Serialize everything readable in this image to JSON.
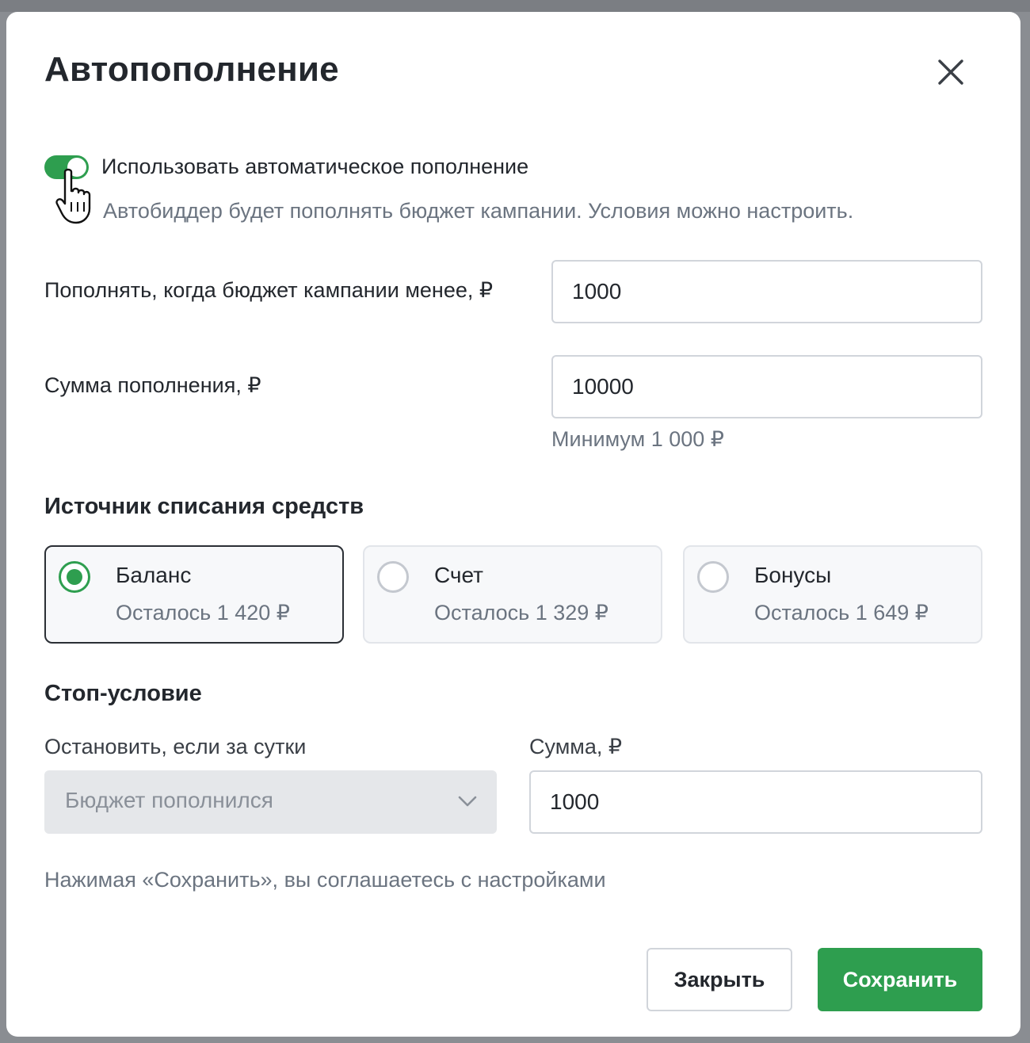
{
  "modal": {
    "title": "Автопополнение",
    "close_icon": "close-icon"
  },
  "autofill": {
    "enabled": true,
    "label": "Использовать автоматическое пополнение",
    "description": "Автобиддер будет пополнять бюджет кампании. Условия можно настроить."
  },
  "threshold": {
    "label": "Пополнять, когда бюджет кампании менее, ₽",
    "value": "1000"
  },
  "amount": {
    "label": "Сумма пополнения, ₽",
    "value": "10000",
    "hint": "Минимум 1 000 ₽"
  },
  "source": {
    "title": "Источник списания средств",
    "options": [
      {
        "name": "Баланс",
        "remaining": "Осталось 1 420 ₽",
        "selected": true
      },
      {
        "name": "Счет",
        "remaining": "Осталось 1 329 ₽",
        "selected": false
      },
      {
        "name": "Бонусы",
        "remaining": "Осталось 1 649 ₽",
        "selected": false
      }
    ]
  },
  "stop": {
    "title": "Стоп-условие",
    "condition_label": "Остановить, если за сутки",
    "condition_value": "Бюджет пополнился",
    "sum_label": "Сумма, ₽",
    "sum_value": "1000"
  },
  "consent": "Нажимая «Сохранить», вы соглашаетесь с настройками",
  "buttons": {
    "close": "Закрыть",
    "save": "Сохранить"
  },
  "colors": {
    "accent": "#2e9e4f",
    "text": "#23272d",
    "muted": "#6b7480"
  }
}
